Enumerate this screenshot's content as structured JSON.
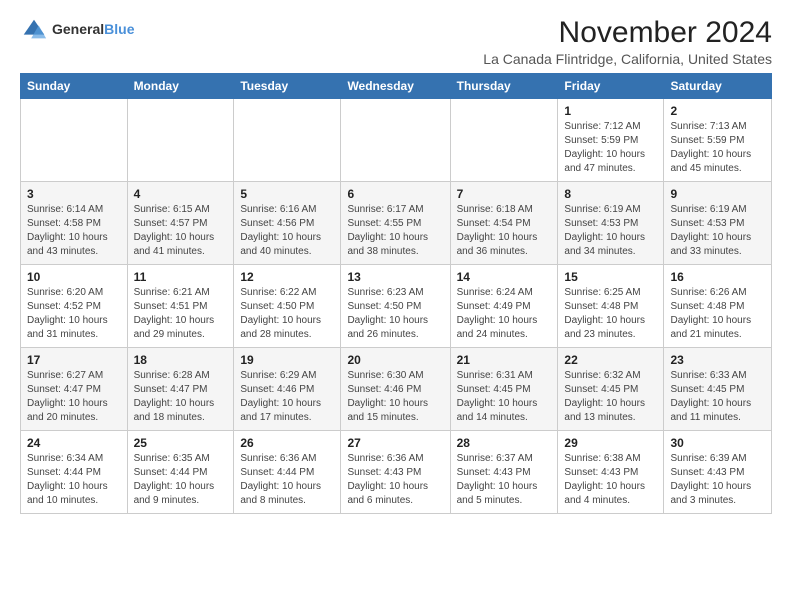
{
  "logo": {
    "general": "General",
    "blue": "Blue"
  },
  "header": {
    "month": "November 2024",
    "location": "La Canada Flintridge, California, United States"
  },
  "weekdays": [
    "Sunday",
    "Monday",
    "Tuesday",
    "Wednesday",
    "Thursday",
    "Friday",
    "Saturday"
  ],
  "weeks": [
    [
      {
        "day": "",
        "info": ""
      },
      {
        "day": "",
        "info": ""
      },
      {
        "day": "",
        "info": ""
      },
      {
        "day": "",
        "info": ""
      },
      {
        "day": "",
        "info": ""
      },
      {
        "day": "1",
        "info": "Sunrise: 7:12 AM\nSunset: 5:59 PM\nDaylight: 10 hours\nand 47 minutes."
      },
      {
        "day": "2",
        "info": "Sunrise: 7:13 AM\nSunset: 5:59 PM\nDaylight: 10 hours\nand 45 minutes."
      }
    ],
    [
      {
        "day": "3",
        "info": "Sunrise: 6:14 AM\nSunset: 4:58 PM\nDaylight: 10 hours\nand 43 minutes."
      },
      {
        "day": "4",
        "info": "Sunrise: 6:15 AM\nSunset: 4:57 PM\nDaylight: 10 hours\nand 41 minutes."
      },
      {
        "day": "5",
        "info": "Sunrise: 6:16 AM\nSunset: 4:56 PM\nDaylight: 10 hours\nand 40 minutes."
      },
      {
        "day": "6",
        "info": "Sunrise: 6:17 AM\nSunset: 4:55 PM\nDaylight: 10 hours\nand 38 minutes."
      },
      {
        "day": "7",
        "info": "Sunrise: 6:18 AM\nSunset: 4:54 PM\nDaylight: 10 hours\nand 36 minutes."
      },
      {
        "day": "8",
        "info": "Sunrise: 6:19 AM\nSunset: 4:53 PM\nDaylight: 10 hours\nand 34 minutes."
      },
      {
        "day": "9",
        "info": "Sunrise: 6:19 AM\nSunset: 4:53 PM\nDaylight: 10 hours\nand 33 minutes."
      }
    ],
    [
      {
        "day": "10",
        "info": "Sunrise: 6:20 AM\nSunset: 4:52 PM\nDaylight: 10 hours\nand 31 minutes."
      },
      {
        "day": "11",
        "info": "Sunrise: 6:21 AM\nSunset: 4:51 PM\nDaylight: 10 hours\nand 29 minutes."
      },
      {
        "day": "12",
        "info": "Sunrise: 6:22 AM\nSunset: 4:50 PM\nDaylight: 10 hours\nand 28 minutes."
      },
      {
        "day": "13",
        "info": "Sunrise: 6:23 AM\nSunset: 4:50 PM\nDaylight: 10 hours\nand 26 minutes."
      },
      {
        "day": "14",
        "info": "Sunrise: 6:24 AM\nSunset: 4:49 PM\nDaylight: 10 hours\nand 24 minutes."
      },
      {
        "day": "15",
        "info": "Sunrise: 6:25 AM\nSunset: 4:48 PM\nDaylight: 10 hours\nand 23 minutes."
      },
      {
        "day": "16",
        "info": "Sunrise: 6:26 AM\nSunset: 4:48 PM\nDaylight: 10 hours\nand 21 minutes."
      }
    ],
    [
      {
        "day": "17",
        "info": "Sunrise: 6:27 AM\nSunset: 4:47 PM\nDaylight: 10 hours\nand 20 minutes."
      },
      {
        "day": "18",
        "info": "Sunrise: 6:28 AM\nSunset: 4:47 PM\nDaylight: 10 hours\nand 18 minutes."
      },
      {
        "day": "19",
        "info": "Sunrise: 6:29 AM\nSunset: 4:46 PM\nDaylight: 10 hours\nand 17 minutes."
      },
      {
        "day": "20",
        "info": "Sunrise: 6:30 AM\nSunset: 4:46 PM\nDaylight: 10 hours\nand 15 minutes."
      },
      {
        "day": "21",
        "info": "Sunrise: 6:31 AM\nSunset: 4:45 PM\nDaylight: 10 hours\nand 14 minutes."
      },
      {
        "day": "22",
        "info": "Sunrise: 6:32 AM\nSunset: 4:45 PM\nDaylight: 10 hours\nand 13 minutes."
      },
      {
        "day": "23",
        "info": "Sunrise: 6:33 AM\nSunset: 4:45 PM\nDaylight: 10 hours\nand 11 minutes."
      }
    ],
    [
      {
        "day": "24",
        "info": "Sunrise: 6:34 AM\nSunset: 4:44 PM\nDaylight: 10 hours\nand 10 minutes."
      },
      {
        "day": "25",
        "info": "Sunrise: 6:35 AM\nSunset: 4:44 PM\nDaylight: 10 hours\nand 9 minutes."
      },
      {
        "day": "26",
        "info": "Sunrise: 6:36 AM\nSunset: 4:44 PM\nDaylight: 10 hours\nand 8 minutes."
      },
      {
        "day": "27",
        "info": "Sunrise: 6:36 AM\nSunset: 4:43 PM\nDaylight: 10 hours\nand 6 minutes."
      },
      {
        "day": "28",
        "info": "Sunrise: 6:37 AM\nSunset: 4:43 PM\nDaylight: 10 hours\nand 5 minutes."
      },
      {
        "day": "29",
        "info": "Sunrise: 6:38 AM\nSunset: 4:43 PM\nDaylight: 10 hours\nand 4 minutes."
      },
      {
        "day": "30",
        "info": "Sunrise: 6:39 AM\nSunset: 4:43 PM\nDaylight: 10 hours\nand 3 minutes."
      }
    ]
  ]
}
